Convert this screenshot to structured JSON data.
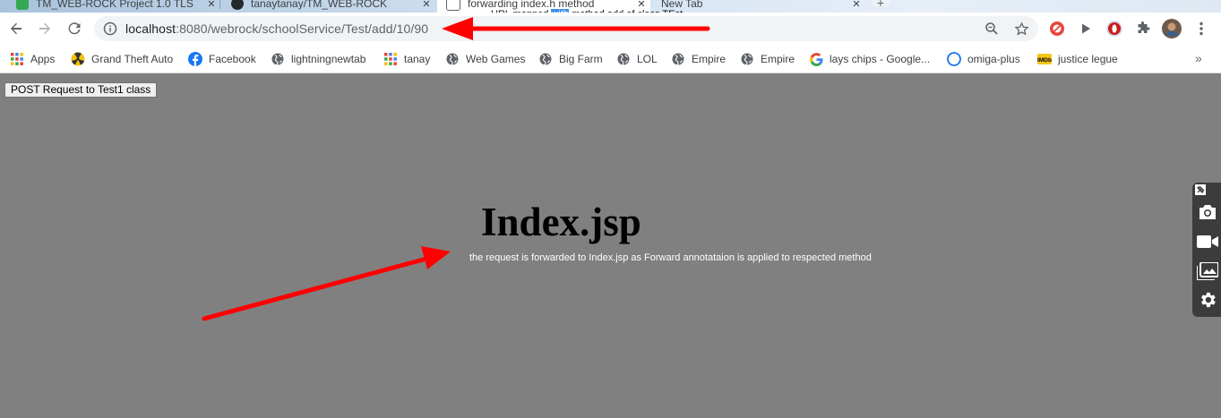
{
  "tabs": [
    {
      "title": "TM_WEB-ROCK Project 1.0 TLS",
      "active": false,
      "icon_color": "#34a853"
    },
    {
      "title": "tanaytanay/TM_WEB-ROCK",
      "active": false,
      "icon_color": "#24292e"
    },
    {
      "title": "forwarding index.h method",
      "active": true,
      "icon_color": "#5f6368"
    },
    {
      "title": "New Tab",
      "active": false,
      "icon_color": "#5f6368"
    }
  ],
  "url_annotation": {
    "before": "URL mapped ",
    "highlight": "with",
    "after": " method add of class TEst"
  },
  "address_bar": {
    "host": "localhost",
    "rest": ":8080/webrock/schoolService/Test/add/10/90"
  },
  "bookmarks": [
    {
      "label": "Apps",
      "icon": "apps-grid-icon"
    },
    {
      "label": "Grand Theft Auto",
      "icon": "radiation-icon"
    },
    {
      "label": "Facebook",
      "icon": "facebook-icon"
    },
    {
      "label": "lightningnewtab",
      "icon": "globe-icon"
    },
    {
      "label": "tanay",
      "icon": "apps-grid-icon"
    },
    {
      "label": "Web Games",
      "icon": "globe-icon"
    },
    {
      "label": "Big Farm",
      "icon": "globe-icon"
    },
    {
      "label": "LOL",
      "icon": "globe-icon"
    },
    {
      "label": "Empire",
      "icon": "globe-icon"
    },
    {
      "label": "Empire",
      "icon": "globe-icon"
    },
    {
      "label": "lays chips - Google...",
      "icon": "google-icon"
    },
    {
      "label": "omiga-plus",
      "icon": "circle-icon"
    },
    {
      "label": "justice legue",
      "icon": "imdb-icon"
    }
  ],
  "bookmarks_overflow": "»",
  "page": {
    "button_label": "POST Request to Test1 class",
    "heading": "Index.jsp",
    "message": "the request is forwarded to Index.jsp as Forward annotataion is applied to respected method"
  },
  "colors": {
    "page_bg": "#808080",
    "arrow": "#ff0000",
    "panel_bg": "#3c3c3c"
  }
}
